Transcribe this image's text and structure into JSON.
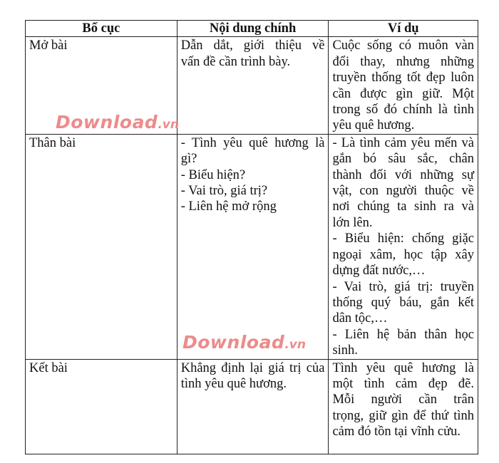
{
  "table": {
    "headers": [
      "Bố cục",
      "Nội dung chính",
      "Ví dụ"
    ],
    "rows": [
      {
        "section": "Mở bài",
        "content_lines": [
          "Dẫn dắt, giới thiệu về",
          "vấn đề cần trình bày."
        ],
        "example_lines": [
          "Cuộc sống có muôn vàn",
          "đổi thay, nhưng những",
          "truyền thống tốt đẹp luôn",
          "cần được gìn giữ. Một",
          "trong số đó chính là tình",
          "yêu quê hương."
        ]
      },
      {
        "section": "Thân bài",
        "content_lines": [
          "- Tình yêu quê hương là",
          "gì?",
          "- Biểu hiện?",
          "- Vai trò, giá trị?",
          "- Liên hệ mở rộng"
        ],
        "example_lines": [
          "- Là tình cảm yêu mến và",
          "gắn bó sâu sắc, chân",
          "thành đối với những sự",
          "vật, con người thuộc về",
          "nơi chúng ta sinh ra và",
          "lớn lên.",
          "- Biểu hiện: chống giặc",
          "ngoại xâm, học tập xây",
          "dựng đất nước,…",
          "- Vai trò, giá trị: truyền",
          "thống quý báu, gắn kết",
          "dân tộc,…",
          "- Liên hệ bản thân học",
          "sinh."
        ]
      },
      {
        "section": "Kết bài",
        "content_lines": [
          "Khẳng định lại giá trị của",
          "tình yêu quê hương."
        ],
        "example_lines": [
          "Tình yêu quê hương là",
          "một tình cảm đẹp đẽ.",
          "Mỗi người cần trân",
          "trọng, giữ gìn để thứ tình",
          "cảm đó tồn tại vĩnh cửu."
        ]
      }
    ]
  },
  "watermark": {
    "brand": "Download",
    "tld": ".vn",
    "color": "#ec7f7f"
  }
}
